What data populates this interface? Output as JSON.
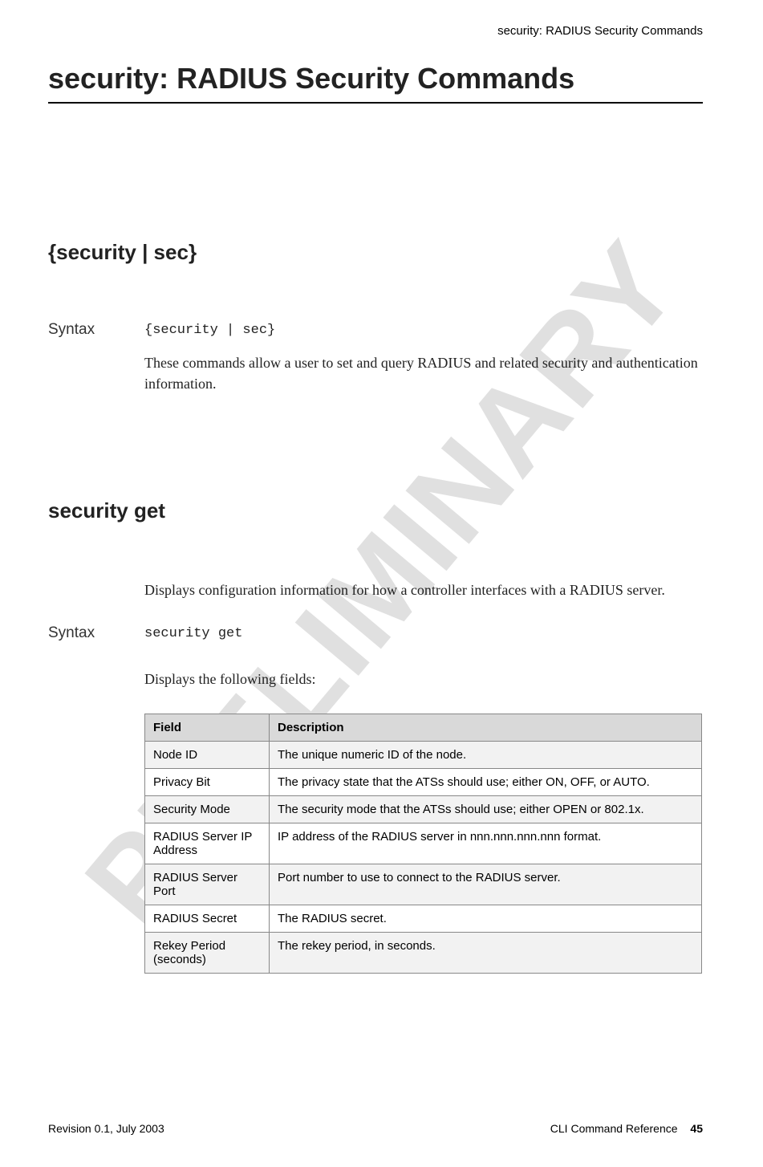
{
  "header": {
    "running_title": "security: RADIUS Security Commands"
  },
  "title": "security: RADIUS Security Commands",
  "section1": {
    "heading": "{security | sec}",
    "syntax_label": "Syntax",
    "syntax_code": "{security | sec}",
    "description": "These commands allow a user to set and query RADIUS and related security and authentication information."
  },
  "section2": {
    "heading": "security get",
    "intro": "Displays configuration information for how a controller interfaces with a RADIUS server.",
    "syntax_label": "Syntax",
    "syntax_code": "security get",
    "fields_intro": "Displays the following fields:",
    "table": {
      "head": {
        "field": "Field",
        "description": "Description"
      },
      "rows": [
        {
          "field": "Node ID",
          "description": "The unique numeric ID of the node."
        },
        {
          "field": "Privacy Bit",
          "description": "The privacy state that the ATSs should use; either ON, OFF, or AUTO."
        },
        {
          "field": "Security Mode",
          "description": "The security mode that the ATSs should use; either OPEN or 802.1x."
        },
        {
          "field": "RADIUS Server IP Address",
          "description": "IP address of the RADIUS server in nnn.nnn.nnn.nnn format."
        },
        {
          "field": "RADIUS Server Port",
          "description": "Port number to use to connect to the RADIUS server."
        },
        {
          "field": "RADIUS Secret",
          "description": "The RADIUS secret."
        },
        {
          "field": "Rekey Period (seconds)",
          "description": "The rekey period, in seconds."
        }
      ]
    }
  },
  "watermark": "PRELIMINARY",
  "footer": {
    "revision": "Revision 0.1, July 2003",
    "doc": "CLI Command Reference",
    "page": "45"
  }
}
